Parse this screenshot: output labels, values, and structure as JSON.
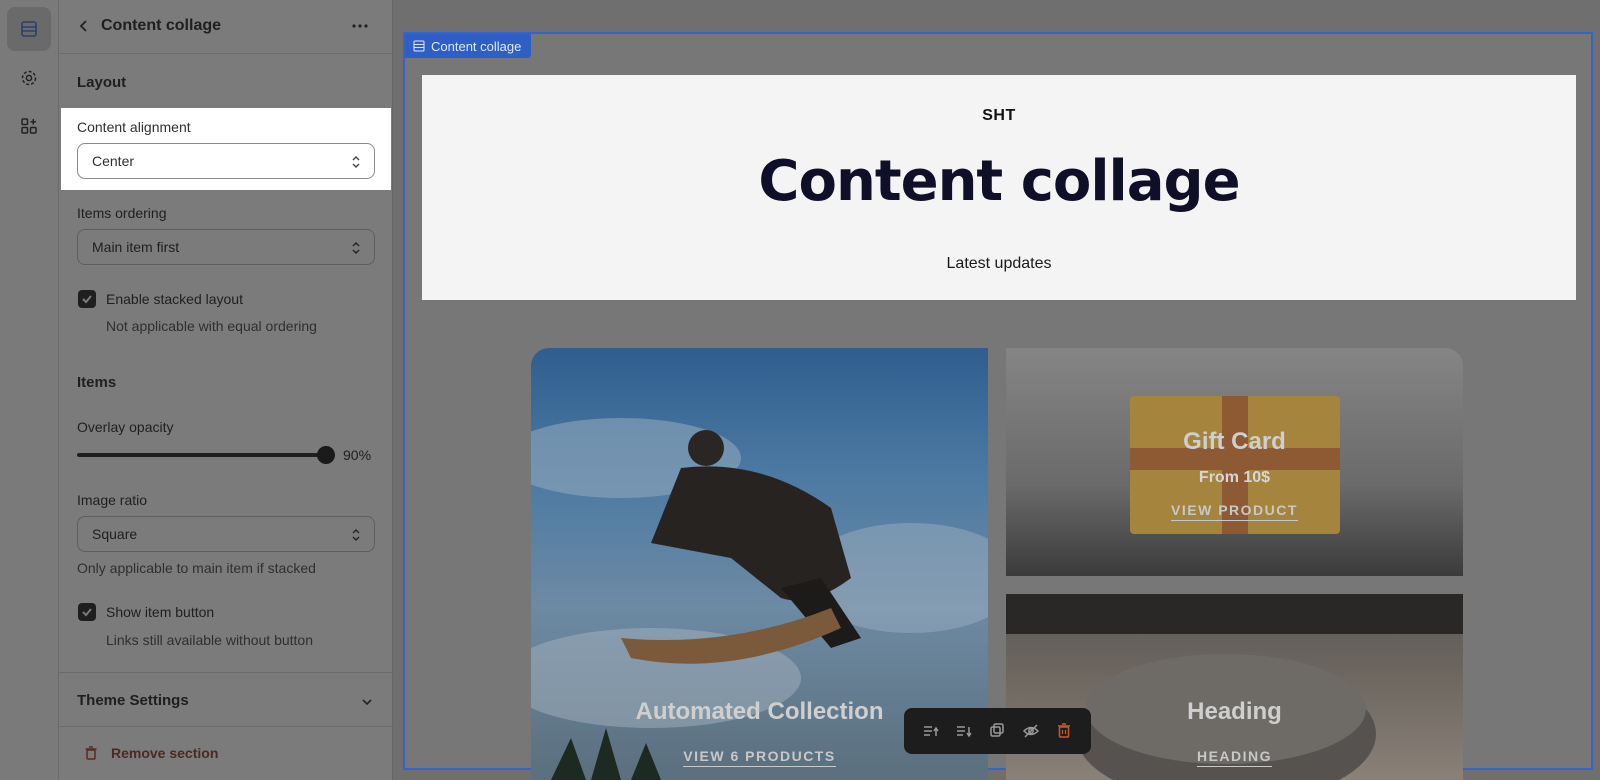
{
  "panel": {
    "title": "Content collage",
    "layout_heading": "Layout",
    "content_alignment": {
      "label": "Content alignment",
      "value": "Center"
    },
    "items_ordering": {
      "label": "Items ordering",
      "value": "Main item first"
    },
    "stacked": {
      "label": "Enable stacked layout",
      "help": "Not applicable with equal ordering",
      "checked": true
    },
    "items_heading": "Items",
    "overlay_opacity": {
      "label": "Overlay opacity",
      "value_text": "90%",
      "value": 90
    },
    "image_ratio": {
      "label": "Image ratio",
      "value": "Square",
      "help": "Only applicable to main item if stacked"
    },
    "show_button": {
      "label": "Show item button",
      "help": "Links still available without button",
      "checked": true
    },
    "theme_settings": "Theme Settings",
    "remove_section": "Remove section"
  },
  "preview": {
    "section_tag": "Content collage",
    "hero": {
      "subheading": "SHT",
      "title": "Content collage",
      "description": "Latest updates"
    },
    "cards": {
      "main": {
        "title": "Automated Collection",
        "link": "VIEW 6 PRODUCTS"
      },
      "gift": {
        "title": "Gift Card",
        "subtitle": "From 10$",
        "link": "VIEW PRODUCT"
      },
      "speaker": {
        "title": "Heading",
        "link": "HEADING"
      }
    }
  },
  "icons": {
    "rail": [
      "sections-icon",
      "gear-icon",
      "apps-icon"
    ],
    "toolbar": [
      "move-up-icon",
      "move-down-icon",
      "duplicate-icon",
      "hide-icon",
      "delete-icon"
    ]
  },
  "colors": {
    "selection_blue": "#2f5fc4",
    "toolbar_bg": "#1d1d1d",
    "delete_red": "#c9582c"
  }
}
